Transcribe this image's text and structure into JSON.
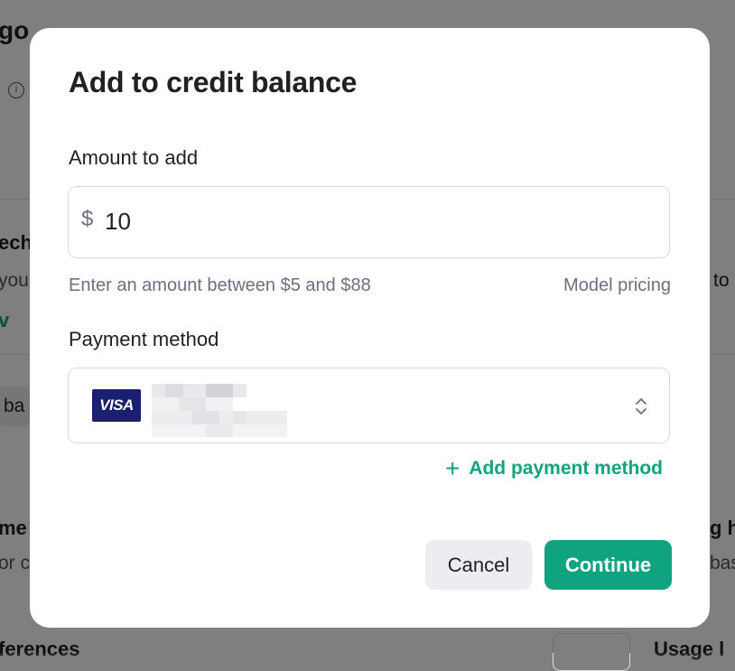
{
  "background": {
    "fragments": [
      "go",
      "ech",
      "you",
      "v",
      "ba",
      "me",
      "or c",
      "to",
      "g h",
      "bas",
      "ferences",
      "Usage l"
    ]
  },
  "modal": {
    "title": "Add to credit balance",
    "amount_label": "Amount to add",
    "currency_symbol": "$",
    "amount_value": "10",
    "helper_text": "Enter an amount between $5 and $88",
    "pricing_link": "Model pricing",
    "payment_label": "Payment method",
    "card_brand": "VISA",
    "add_payment_label": "Add payment method",
    "cancel_label": "Cancel",
    "continue_label": "Continue"
  },
  "colors": {
    "accent": "#10a37f",
    "visa_blue": "#1a1f71",
    "overlay": "rgba(0,0,0,0.5)"
  },
  "icons": {
    "add": "plus-icon",
    "select": "chevron-up-down-icon",
    "info": "info-icon"
  }
}
